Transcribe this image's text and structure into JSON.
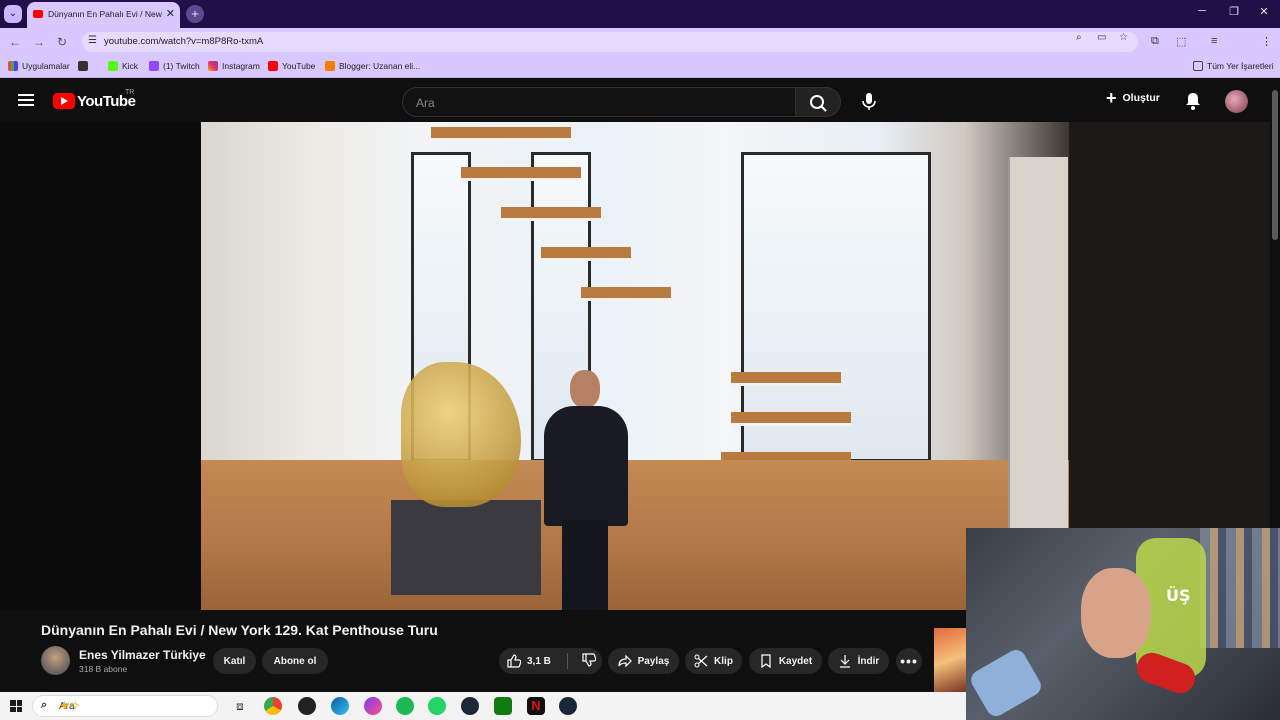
{
  "browser": {
    "tab_title": "Dünyanın En Pahalı Evi / New Y",
    "url": "youtube.com/watch?v=m8P8Ro-txmA",
    "bookmarks": [
      "Uygulamalar",
      "Kick",
      "(1) Twitch",
      "Instagram",
      "YouTube",
      "Blogger: Uzanan eli..."
    ],
    "all_bookmarks": "Tüm Yer İşaretleri",
    "colors": {
      "tabstrip": "#1f1147",
      "toolbar": "#d9c8ff"
    }
  },
  "youtube": {
    "logo_text": "YouTube",
    "country": "TR",
    "search_placeholder": "Ara",
    "create_label": "Oluştur",
    "video": {
      "title": "Dünyanın En Pahalı Evi / New York 129. Kat Penthouse Turu",
      "channel": "Enes Yilmazer Türkiye",
      "subscribers": "318 B abone",
      "join_label": "Katıl",
      "subscribe_label": "Abone ol",
      "likes": "3,1 B",
      "share_label": "Paylaş",
      "clip_label": "Klip",
      "save_label": "Kaydet",
      "download_label": "İndir"
    }
  },
  "webcam": {
    "overlay_text": "ÜŞ"
  },
  "taskbar": {
    "search_placeholder": "Ara"
  }
}
